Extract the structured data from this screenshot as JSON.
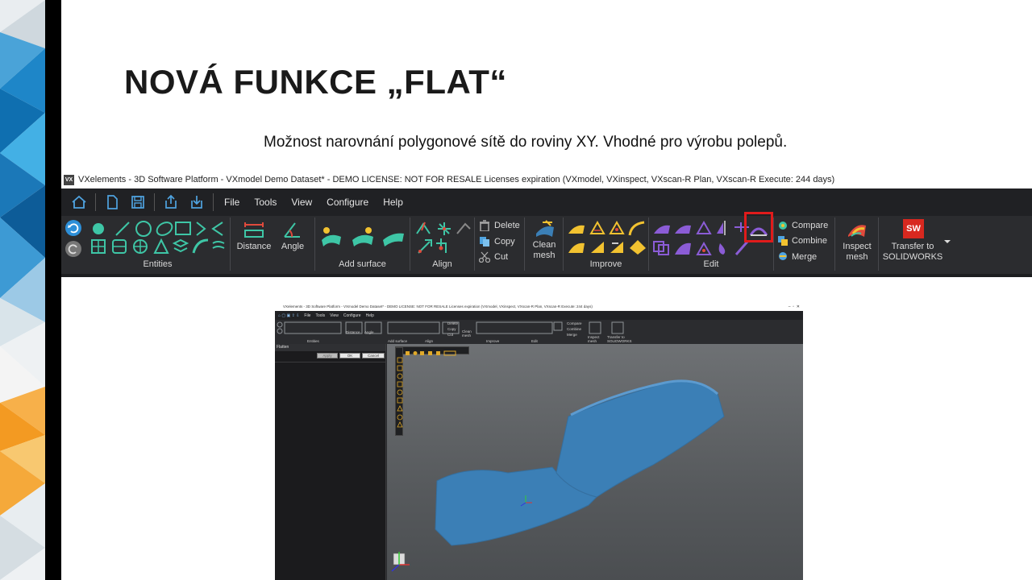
{
  "slide": {
    "title": "NOVÁ FUNKCE „FLAT“",
    "subtitle": "Možnost narovnání polygonové sítě do roviny XY. Vhodné pro výrobu polepů."
  },
  "window": {
    "logo": "VX",
    "title": "VXelements - 3D Software Platform - VXmodel Demo Dataset* - DEMO LICENSE: NOT FOR RESALE Licenses expiration (VXmodel, VXinspect, VXscan-R Plan, VXscan-R Execute: 244 days)",
    "menu": [
      "File",
      "Tools",
      "View",
      "Configure",
      "Help"
    ]
  },
  "ribbon": {
    "groups": {
      "entities": "Entities",
      "add_surface": "Add surface",
      "align": "Align",
      "improve": "Improve",
      "edit": "Edit"
    },
    "tools": {
      "distance": "Distance",
      "angle": "Angle",
      "delete": "Delete",
      "copy": "Copy",
      "cut": "Cut",
      "clean_mesh_1": "Clean",
      "clean_mesh_2": "mesh",
      "compare": "Compare",
      "combine": "Combine",
      "merge": "Merge",
      "inspect_mesh_1": "Inspect",
      "inspect_mesh_2": "mesh",
      "transfer_1": "Transfer to",
      "transfer_2": "SOLIDWORKS",
      "sw_logo": "SW"
    },
    "highlight_color": "#e01b1b",
    "accent_color": "#3ec6a6"
  },
  "nested_screenshot": {
    "title": "VXelements - 3D Software Platform - VXmodel Demo Dataset* - DEMO LICENSE: NOT FOR RESALE Licenses expiration (VXmodel, VXinspect, VXscan-R Plan, VXscan-R Execute: 244 days)",
    "menu": [
      "File",
      "Tools",
      "View",
      "Configure",
      "Help"
    ],
    "ribbon_labels": {
      "entities": "Entities",
      "add_surface": "Add surface",
      "align": "Align",
      "improve": "Improve",
      "edit": "Edit",
      "delete": "Delete",
      "copy": "Copy",
      "cut": "Cut",
      "compare": "Compare",
      "combine": "Combine",
      "merge": "Merge",
      "clean_mesh": "Clean mesh",
      "inspect_mesh": "Inspect mesh",
      "transfer": "Transfer to SOLIDWORKS",
      "distance": "Distance",
      "angle": "Angle"
    },
    "panel_title": "Flatten",
    "buttons": {
      "apply": "Apply",
      "ok": "OK",
      "cancel": "Cancel"
    },
    "mesh_color": "#3b7fb6"
  }
}
